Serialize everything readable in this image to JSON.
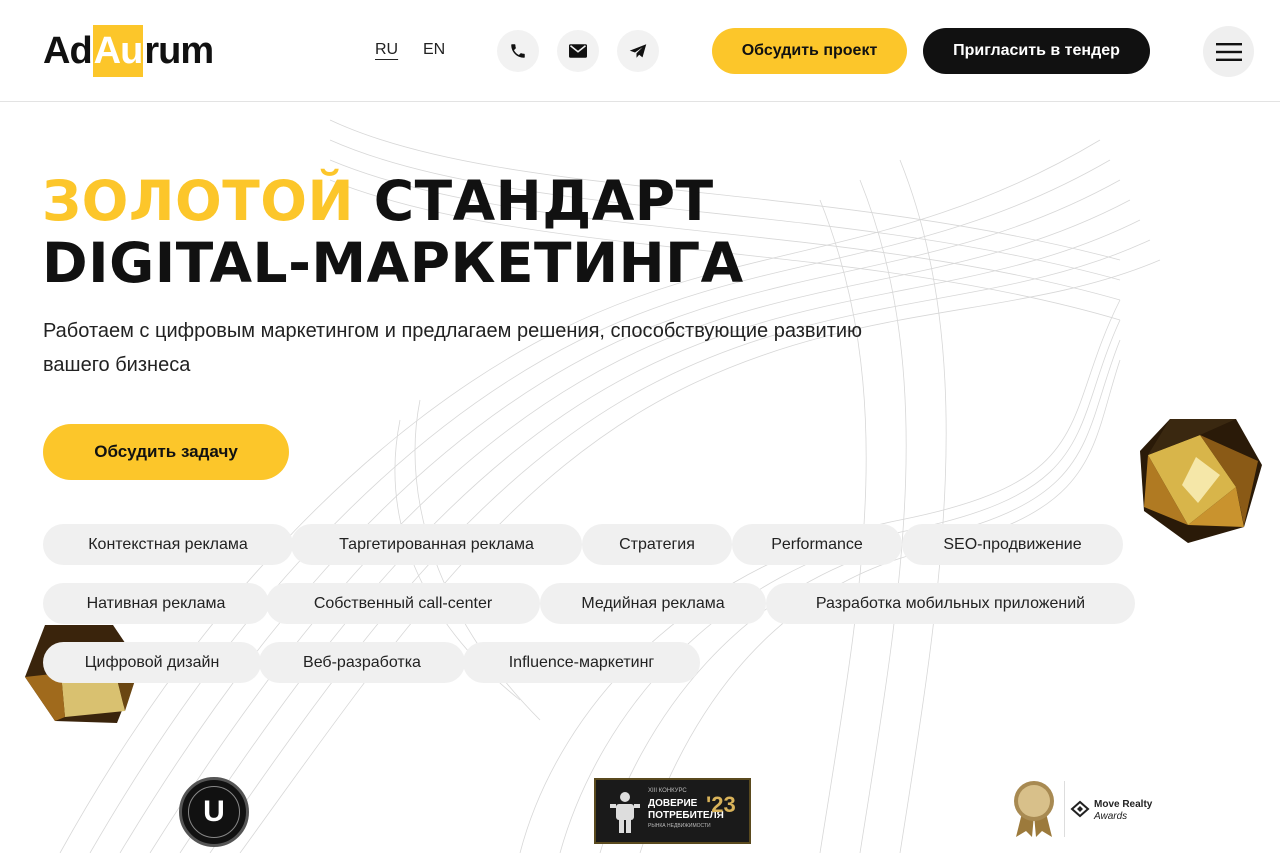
{
  "header": {
    "logo": {
      "left": "Ad",
      "middle": "Au",
      "right": "rum"
    },
    "languages": [
      {
        "label": "RU",
        "active": true
      },
      {
        "label": "EN",
        "active": false
      }
    ],
    "contact_icons": [
      "phone-icon",
      "mail-icon",
      "telegram-icon"
    ],
    "discuss_project_label": "Обсудить проект",
    "tender_label": "Пригласить в тендер",
    "menu_icon": "menu-icon"
  },
  "hero": {
    "title_gold": "ЗОЛОТОЙ",
    "title_rest_line1": "СТАНДАРТ",
    "title_line2": "DIGITAL-МАРКЕТИНГА",
    "subtitle": "Работаем с цифровым маркетингом и предлагаем решения, способствующие развитию вашего бизнеса",
    "cta_label": "Обсудить задачу"
  },
  "services": [
    "Контекстная реклама",
    "Таргетированная реклама",
    "Стратегия",
    "Performance",
    "SEO-продвижение",
    "Нативная реклама",
    "Собственный call-center",
    "Медийная реклама",
    "Разработка мобильных приложений",
    "Цифровой дизайн",
    "Веб-разработка",
    "Influence-маркетинг"
  ],
  "awards": {
    "u_letter": "U",
    "trust": {
      "small": "XIII КОНКУРС",
      "line1": "ДОВЕРИЕ",
      "line2": "ПОТРЕБИТЕЛЯ",
      "tiny": "РЫНКА НЕДВИЖИМОСТИ",
      "year": "'23"
    },
    "move": {
      "name": "Move Realty",
      "sub": "Awards"
    }
  },
  "colors": {
    "accent": "#fcc62a",
    "dark": "#111111",
    "chip": "#f0f0f0"
  }
}
